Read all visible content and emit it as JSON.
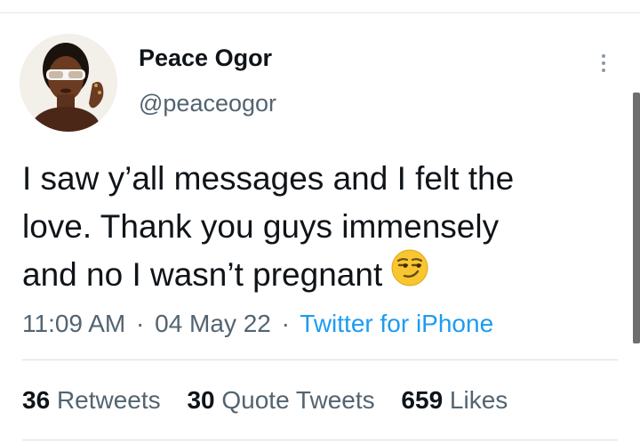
{
  "user": {
    "display_name": "Peace Ogor",
    "handle": "@peaceogor"
  },
  "tweet": {
    "lines": [
      "I saw y’all messages and I felt the",
      "love. Thank you guys immensely",
      "and no I wasn’t pregnant"
    ],
    "emoji": "smirking-face-emoji",
    "time": "11:09 AM",
    "date": "04 May 22",
    "separator": "·",
    "source": "Twitter for iPhone"
  },
  "stats": {
    "retweets_count": "36",
    "retweets_label": "Retweets",
    "quotes_count": "30",
    "quotes_label": "Quote Tweets",
    "likes_count": "659",
    "likes_label": "Likes"
  },
  "colors": {
    "link": "#1d9bf0",
    "secondary_text": "#536471",
    "primary_text": "#0f1419"
  }
}
